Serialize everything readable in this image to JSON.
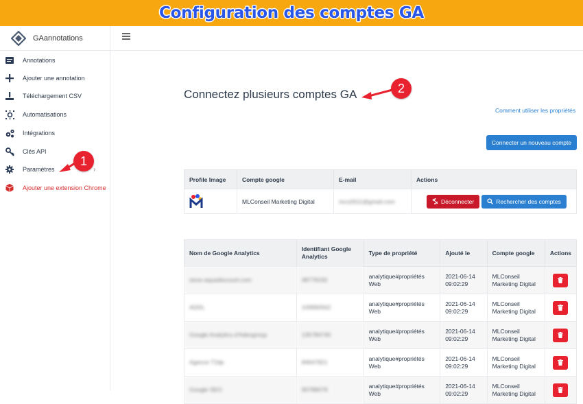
{
  "banner": {
    "title": "Configuration des comptes GA"
  },
  "app": {
    "name": "GAannotations"
  },
  "sidebar": {
    "items": [
      {
        "label": "Annotations",
        "icon": "annotation-icon"
      },
      {
        "label": "Ajouter une annotation",
        "icon": "plus-icon"
      },
      {
        "label": "Téléchargement CSV",
        "icon": "upload-icon"
      },
      {
        "label": "Automatisations",
        "icon": "automation-icon"
      },
      {
        "label": "Intégrations",
        "icon": "integrations-icon"
      },
      {
        "label": "Clés API",
        "icon": "key-icon"
      },
      {
        "label": "Paramètres",
        "icon": "gear-icon"
      },
      {
        "label": "Ajouter une extension Chrome",
        "icon": "extension-icon"
      }
    ]
  },
  "main": {
    "title": "Connectez plusieurs comptes GA",
    "help_link": "Comment utiliser les propriétés",
    "connect_button": "Connecter un nouveau compte"
  },
  "accounts_table": {
    "headers": [
      "Profile Image",
      "Compte google",
      "E-mail",
      "Actions"
    ],
    "rows": [
      {
        "account": "MLConseil Marketing Digital",
        "email": "mco2611@gmail.com",
        "disconnect": "Déconnecter",
        "search": "Rechercher des comptes"
      }
    ]
  },
  "properties_table": {
    "headers": [
      "Nom de Google Analytics",
      "Identifiant Google Analytics",
      "Type de propriété",
      "Ajouté le",
      "Compte google",
      "Actions"
    ],
    "rows": [
      {
        "name": "store-aquadiscount.com",
        "id": "48779192",
        "type": "analytique#propriétés Web",
        "added": "2021-06-14 09:02:29",
        "account": "MLConseil Marketing Digital"
      },
      {
        "name": "ADDL",
        "id": "109990562",
        "type": "analytique#propriétés Web",
        "added": "2021-06-14 09:02:29",
        "account": "MLConseil Marketing Digital"
      },
      {
        "name": "Google Analytics d'Adexgroup",
        "id": "135784740",
        "type": "analytique#propriétés Web",
        "added": "2021-06-14 09:02:29",
        "account": "MLConseil Marketing Digital"
      },
      {
        "name": "Agence T2dp",
        "id": "84647821",
        "type": "analytique#propriétés Web",
        "added": "2021-06-14 09:02:29",
        "account": "MLConseil Marketing Digital"
      },
      {
        "name": "Google SEO",
        "id": "90789079",
        "type": "analytique#propriétés Web",
        "added": "2021-06-14 09:02:29",
        "account": "MLConseil Marketing Digital"
      }
    ]
  },
  "annotations": {
    "badge1": "1",
    "badge2": "2"
  },
  "colors": {
    "banner": "#f7a70f",
    "banner_text": "#2a56e8",
    "primary": "#2a7fd0",
    "danger": "#c8182a",
    "trash": "#e8222f"
  }
}
